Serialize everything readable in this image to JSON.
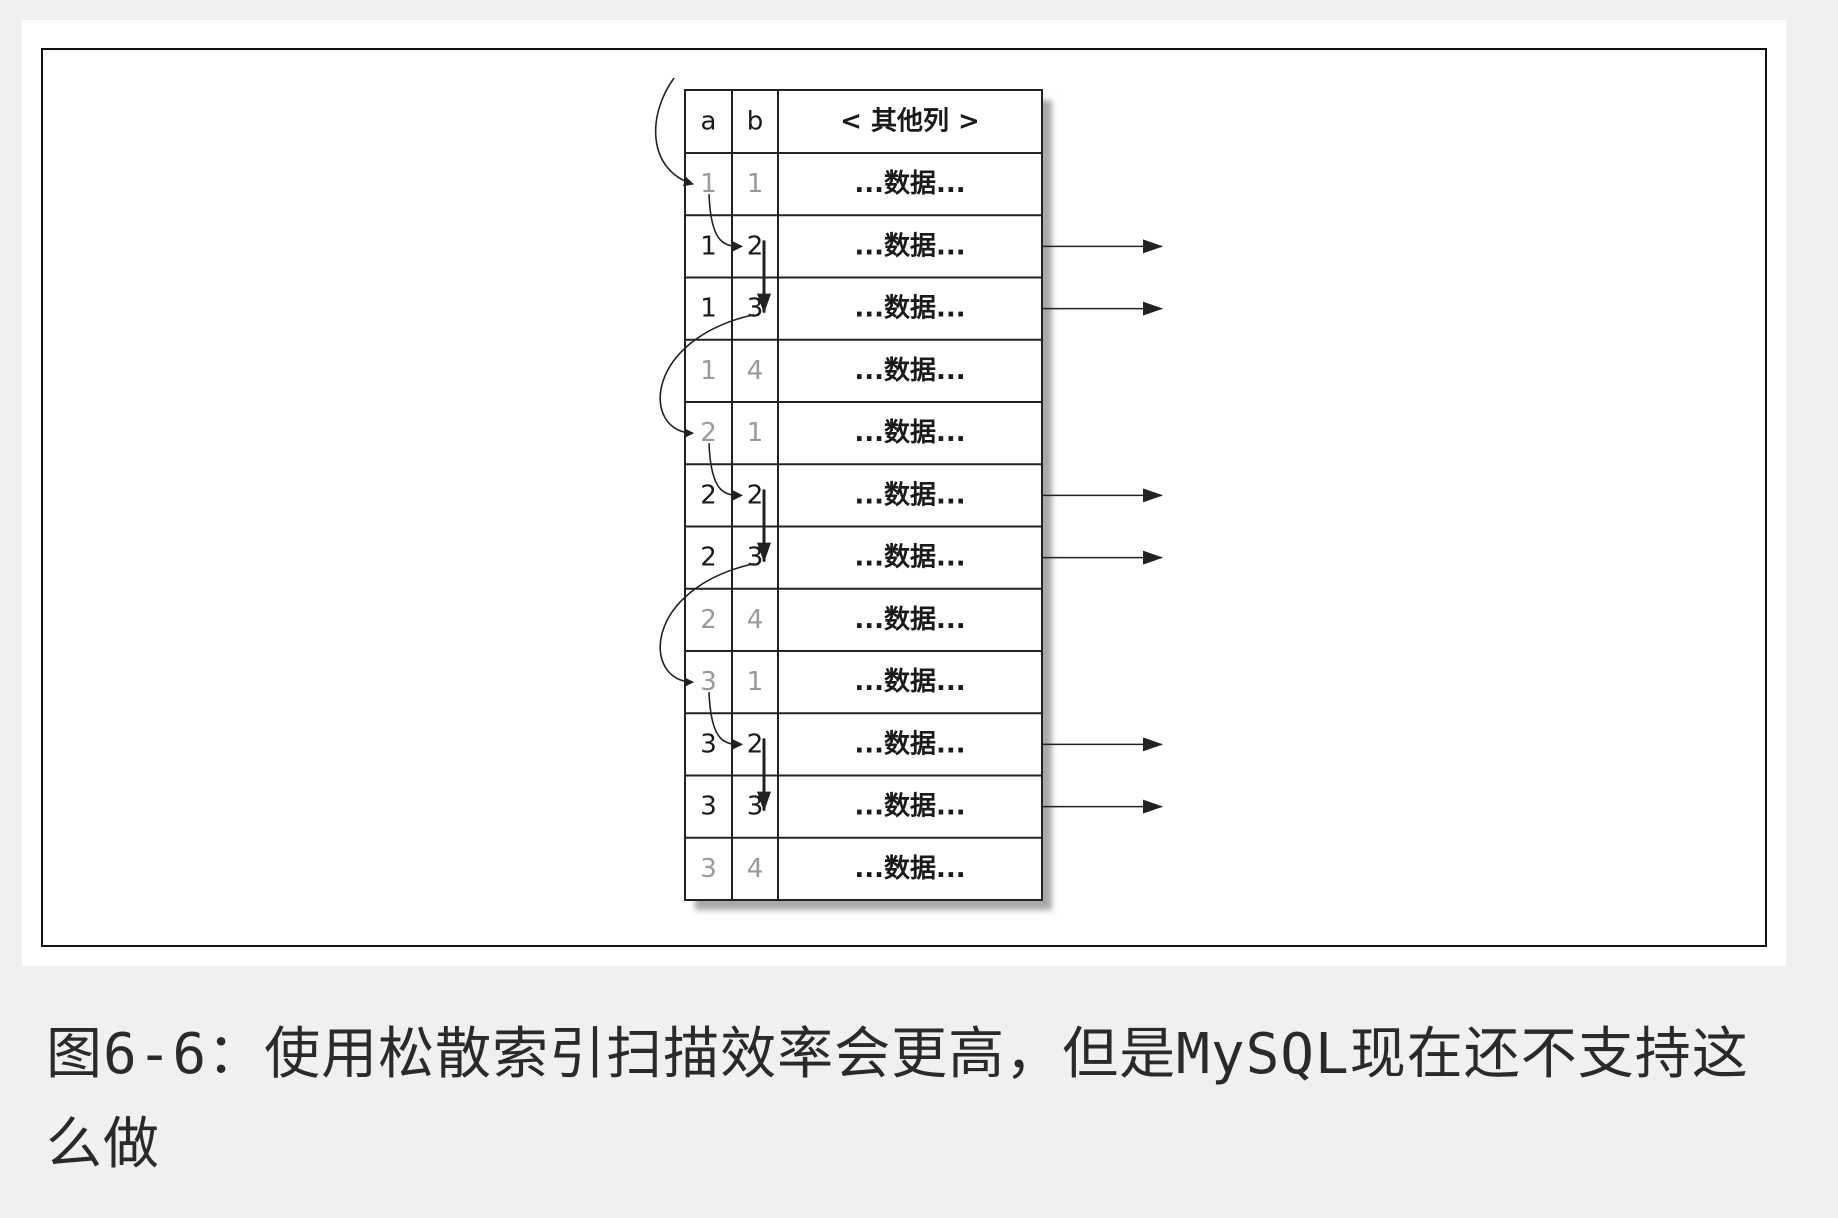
{
  "table": {
    "headers": {
      "a": "a",
      "b": "b",
      "other": "< 其他列 >"
    },
    "rows": [
      {
        "a": "1",
        "b": "1",
        "data": "...数据...",
        "scanned": false,
        "read": false
      },
      {
        "a": "1",
        "b": "2",
        "data": "...数据...",
        "scanned": true,
        "read": true
      },
      {
        "a": "1",
        "b": "3",
        "data": "...数据...",
        "scanned": true,
        "read": true
      },
      {
        "a": "1",
        "b": "4",
        "data": "...数据...",
        "scanned": false,
        "read": false
      },
      {
        "a": "2",
        "b": "1",
        "data": "...数据...",
        "scanned": false,
        "read": false
      },
      {
        "a": "2",
        "b": "2",
        "data": "...数据...",
        "scanned": true,
        "read": true
      },
      {
        "a": "2",
        "b": "3",
        "data": "...数据...",
        "scanned": true,
        "read": true
      },
      {
        "a": "2",
        "b": "4",
        "data": "...数据...",
        "scanned": false,
        "read": false
      },
      {
        "a": "3",
        "b": "1",
        "data": "...数据...",
        "scanned": false,
        "read": false
      },
      {
        "a": "3",
        "b": "2",
        "data": "...数据...",
        "scanned": true,
        "read": true
      },
      {
        "a": "3",
        "b": "3",
        "data": "...数据...",
        "scanned": true,
        "read": true
      },
      {
        "a": "3",
        "b": "4",
        "data": "...数据...",
        "scanned": false,
        "read": false
      }
    ]
  },
  "caption": {
    "line1": "图6-6：使用松散索引扫描效率会更高，但是MySQL现在还不支持这",
    "line2": "么做"
  },
  "colors": {
    "active_text": "#1a1a1a",
    "inactive_text": "#9a9a9a",
    "line": "#222222",
    "shadow": "#a8a8a8"
  }
}
